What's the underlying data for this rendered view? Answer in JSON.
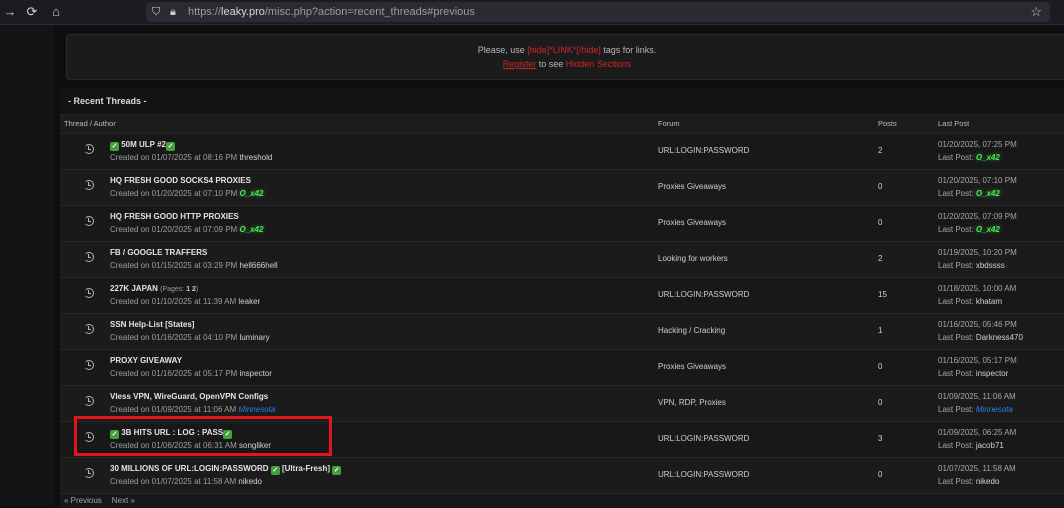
{
  "browser": {
    "url_prefix": "https://",
    "url_host": "leaky.pro",
    "url_path": "/misc.php?action=recent_threads#previous",
    "icons": [
      "back-arrow-icon",
      "reload-icon",
      "home-icon",
      "shield-icon",
      "lock-icon",
      "star-icon"
    ]
  },
  "notice": {
    "line1_a": "Please, use ",
    "line1_tag": "[hide]*LINK*[/hide]",
    "line1_b": " tags for links.",
    "register": "Register",
    "line2_mid": " to see ",
    "hidden": "Hidden Sections"
  },
  "panel": {
    "title": "- Recent Threads -",
    "columns": {
      "thread": "Thread / Author",
      "forum": "Forum",
      "posts": "Posts",
      "last": "Last Post"
    }
  },
  "threads": [
    {
      "title": "50M ULP #2",
      "checks": "both",
      "created": "Created on 01/07/2025 at 08:16 PM",
      "author": "threshold",
      "author_style": "plain",
      "forum": "URL:LOGIN:PASSWORD",
      "posts": "2",
      "last_date": "01/20/2025, 07:25 PM",
      "last_label": "Last Post:",
      "last_author": "O_x42",
      "last_style": "green"
    },
    {
      "title": "HQ FRESH GOOD SOCKS4 PROXIES",
      "checks": "none",
      "created": "Created on 01/20/2025 at 07:10 PM",
      "author": "O_x42",
      "author_style": "green",
      "forum": "Proxies Giveaways",
      "posts": "0",
      "last_date": "01/20/2025, 07:10 PM",
      "last_label": "Last Post:",
      "last_author": "O_x42",
      "last_style": "green"
    },
    {
      "title": "HQ FRESH GOOD HTTP PROXIES",
      "checks": "none",
      "created": "Created on 01/20/2025 at 07:09 PM",
      "author": "O_x42",
      "author_style": "green",
      "forum": "Proxies Giveaways",
      "posts": "0",
      "last_date": "01/20/2025, 07:09 PM",
      "last_label": "Last Post:",
      "last_author": "O_x42",
      "last_style": "green"
    },
    {
      "title": "FB / GOOGLE TRAFFERS",
      "checks": "none",
      "created": "Created on 01/15/2025 at 03:29 PM",
      "author": "hell666hell",
      "author_style": "plain",
      "forum": "Looking for workers",
      "posts": "2",
      "last_date": "01/19/2025, 10:20 PM",
      "last_label": "Last Post:",
      "last_author": "xbdssss",
      "last_style": "plain"
    },
    {
      "title": "227K JAPAN",
      "checks": "none",
      "pages_label": "(Pages:",
      "pages_nums": "1 2",
      "pages_end": ")",
      "created": "Created on 01/10/2025 at 11:39 AM",
      "author": "leaker",
      "author_style": "plain",
      "forum": "URL:LOGIN:PASSWORD",
      "posts": "15",
      "last_date": "01/18/2025, 10:00 AM",
      "last_label": "Last Post:",
      "last_author": "khatam",
      "last_style": "plain"
    },
    {
      "title": "SSN Help-List [States]",
      "checks": "none",
      "created": "Created on 01/16/2025 at 04:10 PM",
      "author": "luminary",
      "author_style": "plain",
      "forum": "Hacking / Cracking",
      "posts": "1",
      "last_date": "01/16/2025, 05:46 PM",
      "last_label": "Last Post:",
      "last_author": "Darkness470",
      "last_style": "plain"
    },
    {
      "title": "PROXY GIVEAWAY",
      "checks": "none",
      "created": "Created on 01/16/2025 at 05:17 PM",
      "author": "inspector",
      "author_style": "plain",
      "forum": "Proxies Giveaways",
      "posts": "0",
      "last_date": "01/16/2025, 05:17 PM",
      "last_label": "Last Post:",
      "last_author": "inspector",
      "last_style": "plain"
    },
    {
      "title": "Vless VPN, WireGuard, OpenVPN Configs",
      "checks": "none",
      "created": "Created on 01/09/2025 at 11:06 AM",
      "author": "Minnesota",
      "author_style": "blue",
      "forum": "VPN, RDP, Proxies",
      "posts": "0",
      "last_date": "01/09/2025, 11:06 AM",
      "last_label": "Last Post:",
      "last_author": "Minnesota",
      "last_style": "blue"
    },
    {
      "title": "3B HITS URL : LOG : PASS",
      "checks": "both",
      "created": "Created on 01/06/2025 at 06:31 AM",
      "author": "songliker",
      "author_style": "plain",
      "forum": "URL:LOGIN:PASSWORD",
      "posts": "3",
      "last_date": "01/09/2025, 06:25 AM",
      "last_label": "Last Post:",
      "last_author": "jacob71",
      "last_style": "plain"
    },
    {
      "title": "30 MILLIONS OF URL:LOGIN:PASSWORD",
      "title_suffix": "[Ultra-Fresh]",
      "checks": "mid",
      "created": "Created on 01/07/2025 at 11:58 AM",
      "author": "nikedo",
      "author_style": "plain",
      "forum": "URL:LOGIN:PASSWORD",
      "posts": "0",
      "last_date": "01/07/2025, 11:58 AM",
      "last_label": "Last Post:",
      "last_author": "nikedo",
      "last_style": "plain"
    }
  ],
  "pager": {
    "prev": "« Previous",
    "next": "Next »"
  }
}
